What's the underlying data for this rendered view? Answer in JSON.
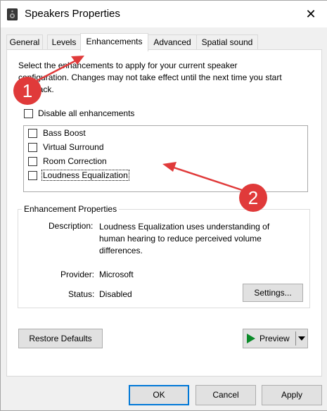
{
  "window": {
    "title": "Speakers Properties",
    "close_glyph": "✕"
  },
  "tabs": [
    {
      "label": "General"
    },
    {
      "label": "Levels"
    },
    {
      "label": "Enhancements"
    },
    {
      "label": "Advanced"
    },
    {
      "label": "Spatial sound"
    }
  ],
  "active_tab": "Enhancements",
  "panel": {
    "intro_line1": "Select the enhancements to apply for your current speaker",
    "intro_line2": "configuration. Changes may not take effect until the next time you start",
    "intro_line3": "playback.",
    "disable_all_label": "Disable all enhancements",
    "disable_all_checked": false,
    "enhancements": [
      {
        "label": "Bass Boost",
        "checked": false
      },
      {
        "label": "Virtual Surround",
        "checked": false
      },
      {
        "label": "Room Correction",
        "checked": false
      },
      {
        "label": "Loudness Equalization",
        "checked": false
      }
    ],
    "properties": {
      "group_title": "Enhancement Properties",
      "description_label": "Description:",
      "description_line1": "Loudness Equalization uses understanding of",
      "description_line2": "human hearing to reduce perceived volume",
      "description_line3": "differences.",
      "provider_label": "Provider:",
      "provider_value": "Microsoft",
      "status_label": "Status:",
      "status_value": "Disabled",
      "settings_button": "Settings..."
    },
    "restore_defaults_button": "Restore Defaults",
    "preview_button": "Preview"
  },
  "footer": {
    "ok": "OK",
    "cancel": "Cancel",
    "apply": "Apply"
  },
  "annotations": {
    "badge1": "1",
    "badge2": "2",
    "color": "#e03a3a"
  },
  "icons": [
    "speaker-icon",
    "close-icon",
    "play-icon",
    "dropdown-arrow-icon"
  ]
}
